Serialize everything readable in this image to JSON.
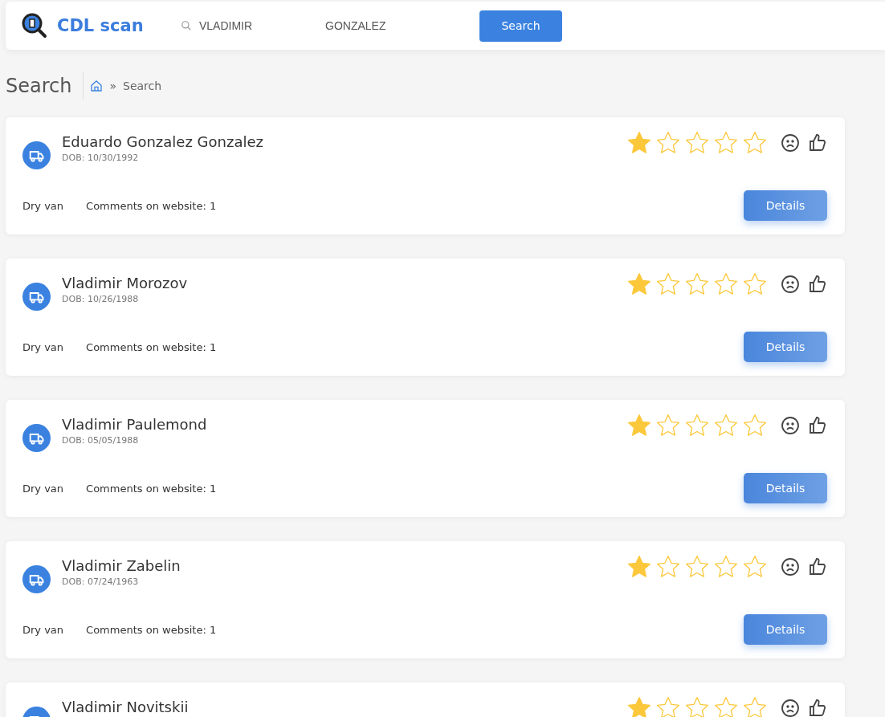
{
  "header": {
    "logo": "CDL scan",
    "first_name": "VLADIMIR",
    "last_name": "GONZALEZ",
    "search_button": "Search"
  },
  "page": {
    "title": "Search",
    "breadcrumb": "»",
    "breadcrumb_current": "Search"
  },
  "results": [
    {
      "name": "Eduardo Gonzalez Gonzalez",
      "dob": "DOB: 10/30/1992",
      "stars": 1,
      "trailer": "Dry van",
      "comments": "Comments on website: 1",
      "button": "Details"
    },
    {
      "name": "Vladimir Morozov",
      "dob": "DOB: 10/26/1988",
      "stars": 1,
      "trailer": "Dry van",
      "comments": "Comments on website: 1",
      "button": "Details"
    },
    {
      "name": "Vladimir Paulemond",
      "dob": "DOB: 05/05/1988",
      "stars": 1,
      "trailer": "Dry van",
      "comments": "Comments on website: 1",
      "button": "Details"
    },
    {
      "name": "Vladimir Zabelin",
      "dob": "DOB: 07/24/1963",
      "stars": 1,
      "trailer": "Dry van",
      "comments": "Comments on website: 1",
      "button": "Details"
    },
    {
      "name": "Vladimir Novitskii",
      "stars": 1
    }
  ]
}
